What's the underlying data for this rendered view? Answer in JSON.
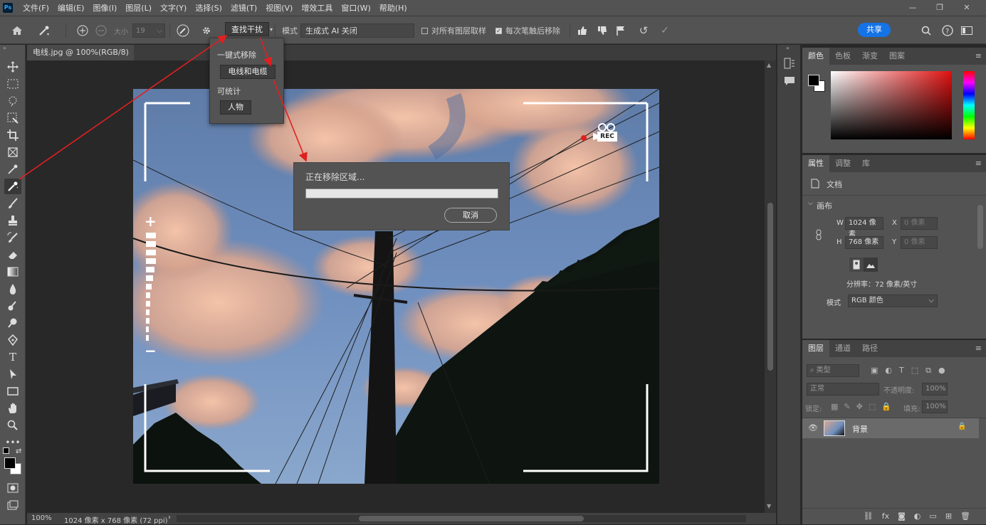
{
  "menubar": {
    "logo": "Ps",
    "items": [
      "文件(F)",
      "编辑(E)",
      "图像(I)",
      "图层(L)",
      "文字(Y)",
      "选择(S)",
      "滤镜(T)",
      "视图(V)",
      "增效工具",
      "窗口(W)",
      "帮助(H)"
    ]
  },
  "options": {
    "size_label": "大小",
    "size_value": "19",
    "find_button": "查找干扰",
    "mode_label": "模式",
    "mode_value": "生成式 AI 关闭",
    "sample_all_label": "对所有图层取样",
    "remove_after_label": "每次笔触后移除",
    "share": "共享"
  },
  "doc_tab": {
    "title": "电线.jpg @ 100%(RGB/8)",
    "close": "×"
  },
  "dropdown": {
    "section1": "一键式移除",
    "btn1": "电线和电缆",
    "section2": "可统计",
    "btn2": "人物"
  },
  "dialog": {
    "message": "正在移除区域...",
    "cancel": "取消",
    "progress": 0
  },
  "overlay": {
    "rec": "REC",
    "plus": "+",
    "minus": "−"
  },
  "status": {
    "zoom": "100%",
    "info": "1024 像素 x 768 像素 (72 ppi)",
    "arrow": "›"
  },
  "color_panel": {
    "tabs": [
      "颜色",
      "色板",
      "渐变",
      "图案"
    ]
  },
  "props_panel": {
    "tabs": [
      "属性",
      "调整",
      "库"
    ],
    "doc_label": "文档",
    "section": "画布",
    "w_label": "W",
    "w_value": "1024 像素",
    "x_label": "X",
    "x_value": "0 像素",
    "h_label": "H",
    "h_value": "768 像素",
    "y_label": "Y",
    "y_value": "0 像素",
    "resolution": "分辨率：72 像素/英寸",
    "mode_label": "模式",
    "mode_value": "RGB 颜色"
  },
  "layers_panel": {
    "tabs": [
      "图层",
      "通道",
      "路径"
    ],
    "filter": "类型",
    "blend": "正常",
    "opacity_label": "不透明度:",
    "opacity_value": "100%",
    "lock_label": "锁定:",
    "fill_label": "填充:",
    "fill_value": "100%",
    "layer_name": "背景"
  },
  "colors": {
    "accent": "#1473e6",
    "ui_bg": "#535353",
    "arrow": "#e02020"
  }
}
